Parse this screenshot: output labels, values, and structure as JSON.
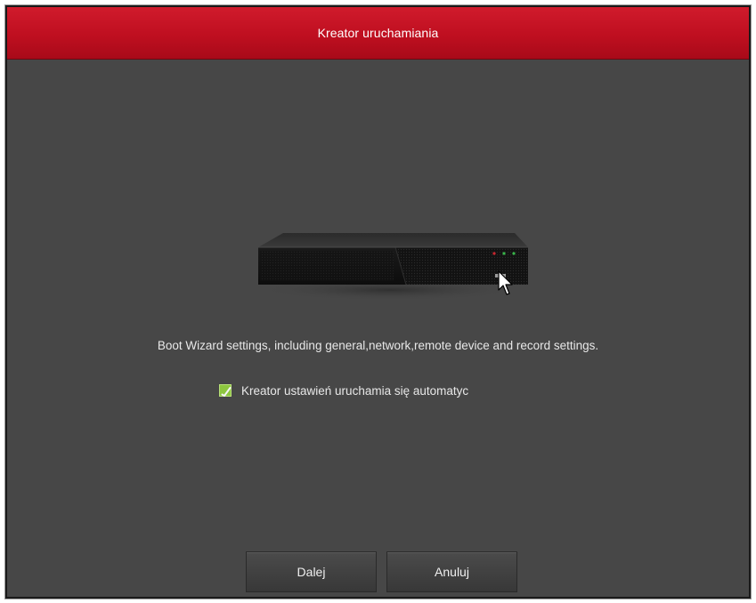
{
  "dialog": {
    "title": "Kreator uruchamiania",
    "description": "Boot Wizard settings, including general,network,remote device and record settings.",
    "auto_start": {
      "label": "Kreator ustawień uruchamia się automatyc",
      "checked": true
    },
    "buttons": {
      "next_label": "Dalej",
      "cancel_label": "Anuluj"
    },
    "icons": {
      "device": "nvr-device-icon",
      "cursor": "mouse-cursor-icon",
      "checkbox": "checkbox-checked-icon"
    },
    "colors": {
      "titlebar": "#c4111f",
      "background": "#474747",
      "checkbox": "#8dc63f",
      "text": "#e8e8e8"
    }
  }
}
